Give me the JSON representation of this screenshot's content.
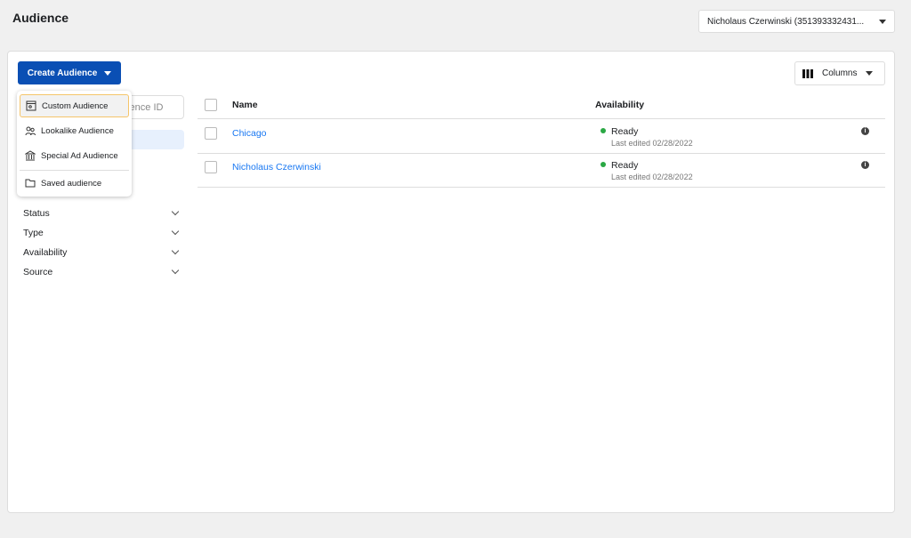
{
  "header": {
    "title": "Audience",
    "account": "Nicholaus Czerwinski (351393332431..."
  },
  "toolbar": {
    "create_label": "Create Audience",
    "columns_label": "Columns"
  },
  "sidebar": {
    "search_placeholder": "dience ID",
    "filters": [
      "Status",
      "Type",
      "Availability",
      "Source"
    ]
  },
  "create_menu": {
    "items": [
      {
        "label": "Custom Audience",
        "icon": "custom-audience-icon"
      },
      {
        "label": "Lookalike Audience",
        "icon": "people-icon"
      },
      {
        "label": "Special Ad Audience",
        "icon": "bank-icon"
      },
      {
        "label": "Saved audience",
        "icon": "folder-icon"
      }
    ]
  },
  "table": {
    "headers": {
      "name": "Name",
      "availability": "Availability"
    },
    "rows": [
      {
        "name": "Chicago",
        "status": "Ready",
        "edited": "Last edited 02/28/2022"
      },
      {
        "name": "Nicholaus Czerwinski",
        "status": "Ready",
        "edited": "Last edited 02/28/2022"
      }
    ]
  },
  "colors": {
    "primary": "#0a4fb4",
    "link": "#1877f2",
    "ready": "#2aa844"
  }
}
